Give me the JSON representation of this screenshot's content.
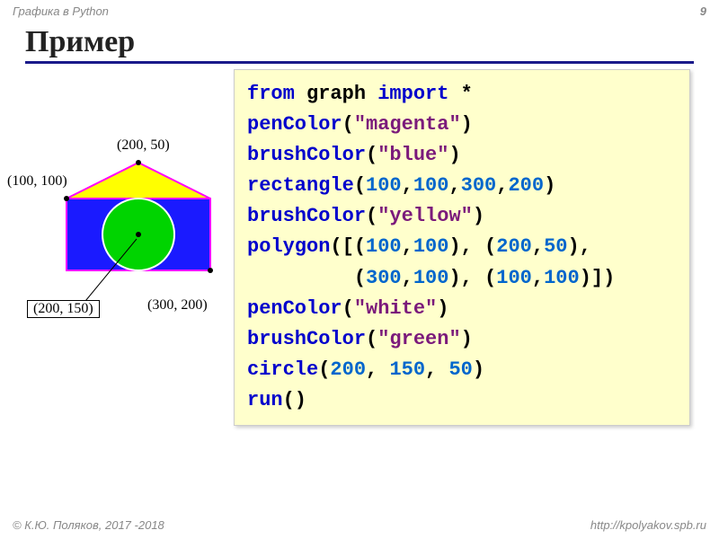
{
  "header": {
    "topic": "Графика в Python",
    "page_number": "9"
  },
  "title": "Пример",
  "figure": {
    "labels": {
      "p1": "(200, 50)",
      "p2": "(100, 100)",
      "p3": "(300, 200)",
      "p4": "(200, 150)"
    }
  },
  "code": {
    "l1_from": "from",
    "l1_graph": " graph ",
    "l1_import": "import",
    "l1_star": " *",
    "l2_fn": "penColor",
    "l2_open": "(",
    "l2_str": "\"magenta\"",
    "l2_close": ")",
    "l3_fn": "brushColor",
    "l3_open": "(",
    "l3_str": "\"blue\"",
    "l3_close": ")",
    "l4_fn": "rectangle",
    "l4_open": "(",
    "l4_n1": "100",
    "l4_c1": ",",
    "l4_n2": "100",
    "l4_c2": ",",
    "l4_n3": "300",
    "l4_c3": ",",
    "l4_n4": "200",
    "l4_close": ")",
    "l5_fn": "brushColor",
    "l5_open": "(",
    "l5_str": "\"yellow\"",
    "l5_close": ")",
    "l6_fn": "polygon",
    "l6_open": "([(",
    "l6_n1": "100",
    "l6_c1": ",",
    "l6_n2": "100",
    "l6_close1": "), (",
    "l6_n3": "200",
    "l6_c2": ",",
    "l6_n4": "50",
    "l6_close2": "),",
    "l7_indent": "         (",
    "l7_n1": "300",
    "l7_c1": ",",
    "l7_n2": "100",
    "l7_close1": "), (",
    "l7_n3": "100",
    "l7_c2": ",",
    "l7_n4": "100",
    "l7_close2": ")])",
    "l8_fn": "penColor",
    "l8_open": "(",
    "l8_str": "\"white\"",
    "l8_close": ")",
    "l9_fn": "brushColor",
    "l9_open": "(",
    "l9_str": "\"green\"",
    "l9_close": ")",
    "l10_fn": "circle",
    "l10_open": "(",
    "l10_n1": "200",
    "l10_c1": ", ",
    "l10_n2": "150",
    "l10_c2": ", ",
    "l10_n3": "50",
    "l10_close": ")",
    "l11_fn": "run",
    "l11_paren": "()"
  },
  "footer": {
    "left": "© К.Ю. Поляков, 2017 -2018",
    "right": "http://kpolyakov.spb.ru"
  }
}
